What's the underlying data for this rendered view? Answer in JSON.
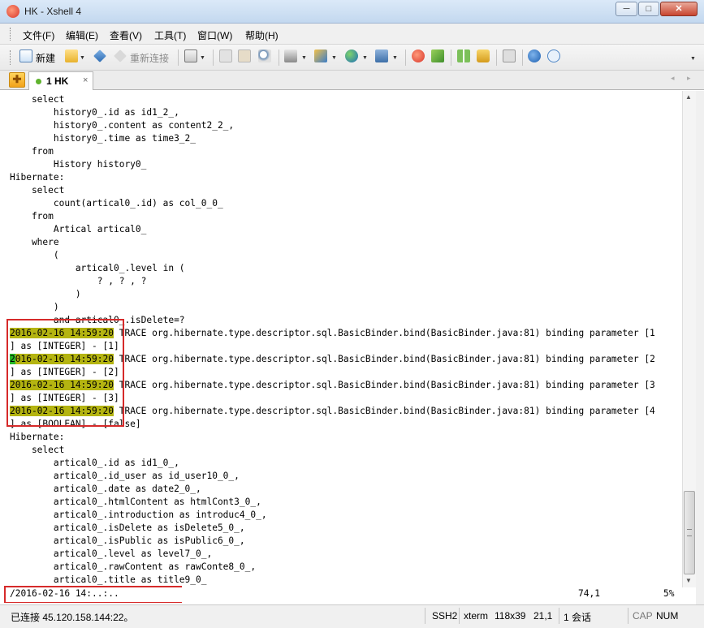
{
  "window": {
    "title": "HK - Xshell 4",
    "min_glyph": "─",
    "max_glyph": "□",
    "close_glyph": "✕"
  },
  "menu": [
    "文件(F)",
    "编辑(E)",
    "查看(V)",
    "工具(T)",
    "窗口(W)",
    "帮助(H)"
  ],
  "toolbar": {
    "new_label": "新建",
    "reconnect_label": "重新连接"
  },
  "tabs": [
    {
      "label": "1 HK",
      "status_color": "#5fb32e",
      "close_glyph": "×"
    }
  ],
  "tab_nav": {
    "prev": "◂",
    "next": "▸"
  },
  "terminal": {
    "lines": [
      "    select",
      "        history0_.id as id1_2_,",
      "        history0_.content as content2_2_,",
      "        history0_.time as time3_2_",
      "    from",
      "        History history0_",
      "Hibernate:",
      "    select",
      "        count(artical0_.id) as col_0_0_",
      "    from",
      "        Artical artical0_",
      "    where",
      "        (",
      "            artical0_.level in (",
      "                ? , ? , ?",
      "            )",
      "        )",
      "        and artical0_.isDelete=?",
      "2016-02-16 14:59:20 TRACE org.hibernate.type.descriptor.sql.BasicBinder.bind(BasicBinder.java:81) binding parameter [1",
      "] as [INTEGER] - [1]",
      "2016-02-16 14:59:20 TRACE org.hibernate.type.descriptor.sql.BasicBinder.bind(BasicBinder.java:81) binding parameter [2",
      "] as [INTEGER] - [2]",
      "2016-02-16 14:59:20 TRACE org.hibernate.type.descriptor.sql.BasicBinder.bind(BasicBinder.java:81) binding parameter [3",
      "] as [INTEGER] - [3]",
      "2016-02-16 14:59:20 TRACE org.hibernate.type.descriptor.sql.BasicBinder.bind(BasicBinder.java:81) binding parameter [4",
      "] as [BOOLEAN] - [false]",
      "Hibernate:",
      "    select",
      "        artical0_.id as id1_0_,",
      "        artical0_.id_user as id_user10_0_,",
      "        artical0_.date as date2_0_,",
      "        artical0_.htmlContent as htmlCont3_0_,",
      "        artical0_.introduction as introduc4_0_,",
      "        artical0_.isDelete as isDelete5_0_,",
      "        artical0_.isPublic as isPublic6_0_,",
      "        artical0_.level as level7_0_,",
      "        artical0_.rawContent as rawConte8_0_,",
      "        artical0_.title as title9_0_"
    ],
    "highlight_color": "#b4b411",
    "cursor_color": "#28b828"
  },
  "command_line": {
    "text": "/2016-02-16 14:..:..",
    "position": "74,1",
    "percent": "5%"
  },
  "scrollbar": {
    "up": "▲",
    "down": "▼"
  },
  "annotation_color": "#d62a2a",
  "status": {
    "connection": "已连接 45.120.158.144:22。",
    "protocol": "SSH2",
    "terminal_type": "xterm",
    "size": "118x39",
    "cursor": "21,1",
    "sessions": "1 会话",
    "cap": "CAP",
    "num": "NUM"
  }
}
